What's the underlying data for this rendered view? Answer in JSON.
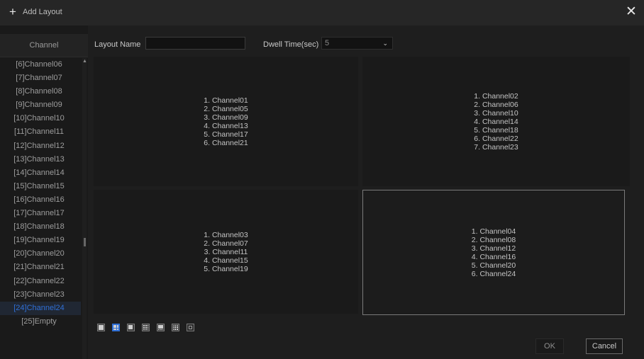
{
  "titlebar": {
    "plus_glyph": "+",
    "title": "Add Layout",
    "close_glyph": "✕"
  },
  "sidebar": {
    "header": "Channel",
    "items": [
      "[6]Channel06",
      "[7]Channel07",
      "[8]Channel08",
      "[9]Channel09",
      "[10]Channel10",
      "[11]Channel11",
      "[12]Channel12",
      "[13]Channel13",
      "[14]Channel14",
      "[15]Channel15",
      "[16]Channel16",
      "[17]Channel17",
      "[18]Channel18",
      "[19]Channel19",
      "[20]Channel20",
      "[21]Channel21",
      "[22]Channel22",
      "[23]Channel23",
      "[24]Channel24",
      "[25]Empty"
    ],
    "selected_index": 18,
    "scroll_up_glyph": "▲"
  },
  "form": {
    "layout_name_label": "Layout Name",
    "layout_name_value": "",
    "dwell_label": "Dwell Time(sec)",
    "dwell_value": "5",
    "dwell_arrow_glyph": "⌄"
  },
  "grid": {
    "cells": [
      {
        "lines": [
          "1. Channel01",
          "2. Channel05",
          "3. Channel09",
          "4. Channel13",
          "5. Channel17",
          "6. Channel21"
        ]
      },
      {
        "lines": [
          "1. Channel02",
          "2. Channel06",
          "3. Channel10",
          "4. Channel14",
          "5. Channel18",
          "6. Channel22",
          "7. Channel23"
        ]
      },
      {
        "lines": [
          "1. Channel03",
          "2. Channel07",
          "3. Channel11",
          "4. Channel15",
          "5. Channel19"
        ]
      },
      {
        "lines": [
          "1. Channel04",
          "2. Channel08",
          "3. Channel12",
          "4. Channel16",
          "5. Channel20",
          "6. Channel24"
        ]
      }
    ]
  },
  "layout_icons": [
    {
      "name": "layout-1-icon"
    },
    {
      "name": "layout-4-icon",
      "active": true
    },
    {
      "name": "layout-6-icon"
    },
    {
      "name": "layout-9-icon"
    },
    {
      "name": "layout-8-icon"
    },
    {
      "name": "layout-16-icon"
    },
    {
      "name": "layout-25-icon"
    }
  ],
  "actions": {
    "ok_label": "OK",
    "cancel_label": "Cancel"
  },
  "colors": {
    "accent": "#2f6fd6",
    "background": "#1e1e1e",
    "selected_border": "#7a7a7a"
  }
}
